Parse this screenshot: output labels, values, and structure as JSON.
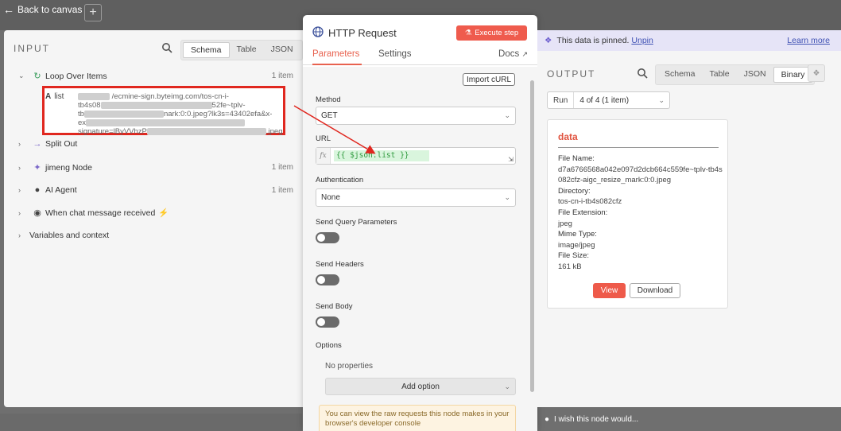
{
  "header": {
    "back_label": "Back to canvas"
  },
  "input": {
    "title": "INPUT",
    "view_tabs": [
      "Schema",
      "Table",
      "JSON"
    ],
    "tree": [
      {
        "label": "Loop Over Items",
        "count": "1 item",
        "icon": "refresh-icon"
      },
      {
        "label": "Split Out",
        "count": "",
        "icon": "split-icon"
      },
      {
        "label": "jimeng Node",
        "count": "1 item",
        "icon": "wand-icon"
      },
      {
        "label": "AI Agent",
        "count": "1 item",
        "icon": "robot-icon"
      },
      {
        "label": "When chat message received",
        "count": "",
        "icon": "chat-icon"
      },
      {
        "label": "Variables and context",
        "count": ""
      }
    ],
    "list_field": {
      "type": "A",
      "name": "list",
      "line1": "/ecmine-sign.byteimg.com/tos-cn-i-",
      "line2": "tb4s08",
      "line2b": "52fe~tplv-",
      "line3": "tb",
      "line3b": "nark:0:0.jpeg?lk3s=43402efa&x-",
      "line4": "ex",
      "line5": "signature=lByVVhzP",
      "line5b": ".jpeg"
    }
  },
  "modal": {
    "title": "HTTP Request",
    "execute_label": "Execute step",
    "tabs": [
      "Parameters",
      "Settings"
    ],
    "docs_label": "Docs",
    "import_curl": "Import cURL",
    "method_label": "Method",
    "method_value": "GET",
    "url_label": "URL",
    "url_value": "{{ $json.list }}",
    "auth_label": "Authentication",
    "auth_value": "None",
    "send_query": "Send Query Parameters",
    "send_headers": "Send Headers",
    "send_body": "Send Body",
    "options_label": "Options",
    "no_properties": "No properties",
    "add_option": "Add option",
    "notice": "You can view the raw requests this node makes in your browser's developer console"
  },
  "output": {
    "pinned_text": "This data is pinned.",
    "unpin": "Unpin",
    "learn_more": "Learn more",
    "title": "OUTPUT",
    "view_tabs": [
      "Schema",
      "Table",
      "JSON",
      "Binary"
    ],
    "run_label": "Run",
    "run_value": "4 of 4 (1 item)",
    "card_title": "data",
    "file_name_key": "File Name:",
    "file_name": "d7a6766568a042e097d2dcb664c559fe~tplv-tb4s082cfz-aigc_resize_mark:0:0.jpeg",
    "directory_key": "Directory:",
    "directory": "tos-cn-i-tb4s082cfz",
    "ext_key": "File Extension:",
    "ext": "jpeg",
    "mime_key": "Mime Type:",
    "mime": "image/jpeg",
    "size_key": "File Size:",
    "size": "161 kB",
    "view_label": "View",
    "download_label": "Download"
  },
  "footer": {
    "wish": "I wish this node would..."
  },
  "colors": {
    "accent": "#ef5b4d",
    "pinned_bg": "#e6e4f7",
    "highlight_red": "#e0271f"
  }
}
